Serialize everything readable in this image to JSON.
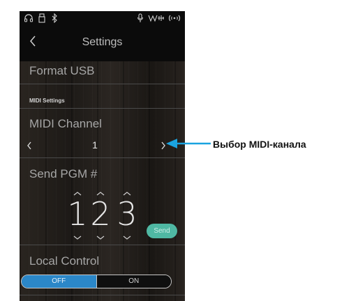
{
  "header": {
    "title": "Settings"
  },
  "rows": {
    "format_usb": "Format USB",
    "midi_settings": "MIDI Settings",
    "midi_channel": "MIDI Channel",
    "channel_value": "1",
    "send_pgm": "Send PGM #",
    "pgm_digits": [
      "1",
      "2",
      "3"
    ],
    "send_button": "Send",
    "local_control": "Local Control",
    "toggle_off": "OFF",
    "toggle_on": "ON"
  },
  "annotation": {
    "label": "Выбор MIDI-канала"
  },
  "status_icons": [
    "headphones-icon",
    "usb-drive-icon",
    "bluetooth-icon",
    "microphone-icon",
    "sound-mode-icon",
    "wireless-icon"
  ],
  "colors": {
    "toggle_active": "#2b87c8",
    "send_button": "#4fb8a3",
    "callout_arrow": "#1aa3e0"
  }
}
